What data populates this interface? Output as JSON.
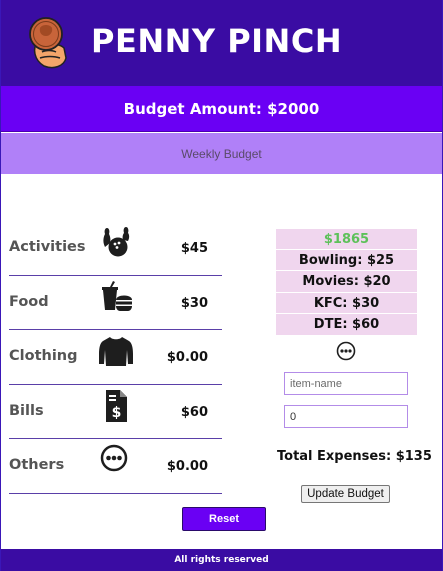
{
  "header": {
    "brand": "PENNY PINCH",
    "logo_icon": "penny-in-hand-icon"
  },
  "budget": {
    "amount_label": "Budget Amount: $2000"
  },
  "weekly": {
    "label": "Weekly Budget"
  },
  "categories": [
    {
      "label": "Activities",
      "icon": "bowling-icon",
      "amount": "$45"
    },
    {
      "label": "Food",
      "icon": "food-icon",
      "amount": "$30"
    },
    {
      "label": "Clothing",
      "icon": "shirt-icon",
      "amount": "$0.00"
    },
    {
      "label": "Bills",
      "icon": "bill-icon",
      "amount": "$60"
    },
    {
      "label": "Others",
      "icon": "more-icon",
      "amount": "$0.00"
    }
  ],
  "summary": {
    "remaining": "$1865",
    "items": [
      "Bowling: $25",
      "Movies: $20",
      "KFC: $30",
      "DTE: $60"
    ],
    "more_icon": "more-icon"
  },
  "form": {
    "item_name_placeholder": "item-name",
    "amount_value": "0",
    "update_label": "Update Budget"
  },
  "total": {
    "label": "Total Expenses: $135"
  },
  "reset_label": "Reset",
  "footer": {
    "text": "All rights reserved"
  },
  "colors": {
    "header": "#3a0ca3",
    "accent": "#6a00f4",
    "weekly": "#b080f8",
    "summary_bg": "#f0d6ee",
    "remaining": "#5dc15a"
  }
}
